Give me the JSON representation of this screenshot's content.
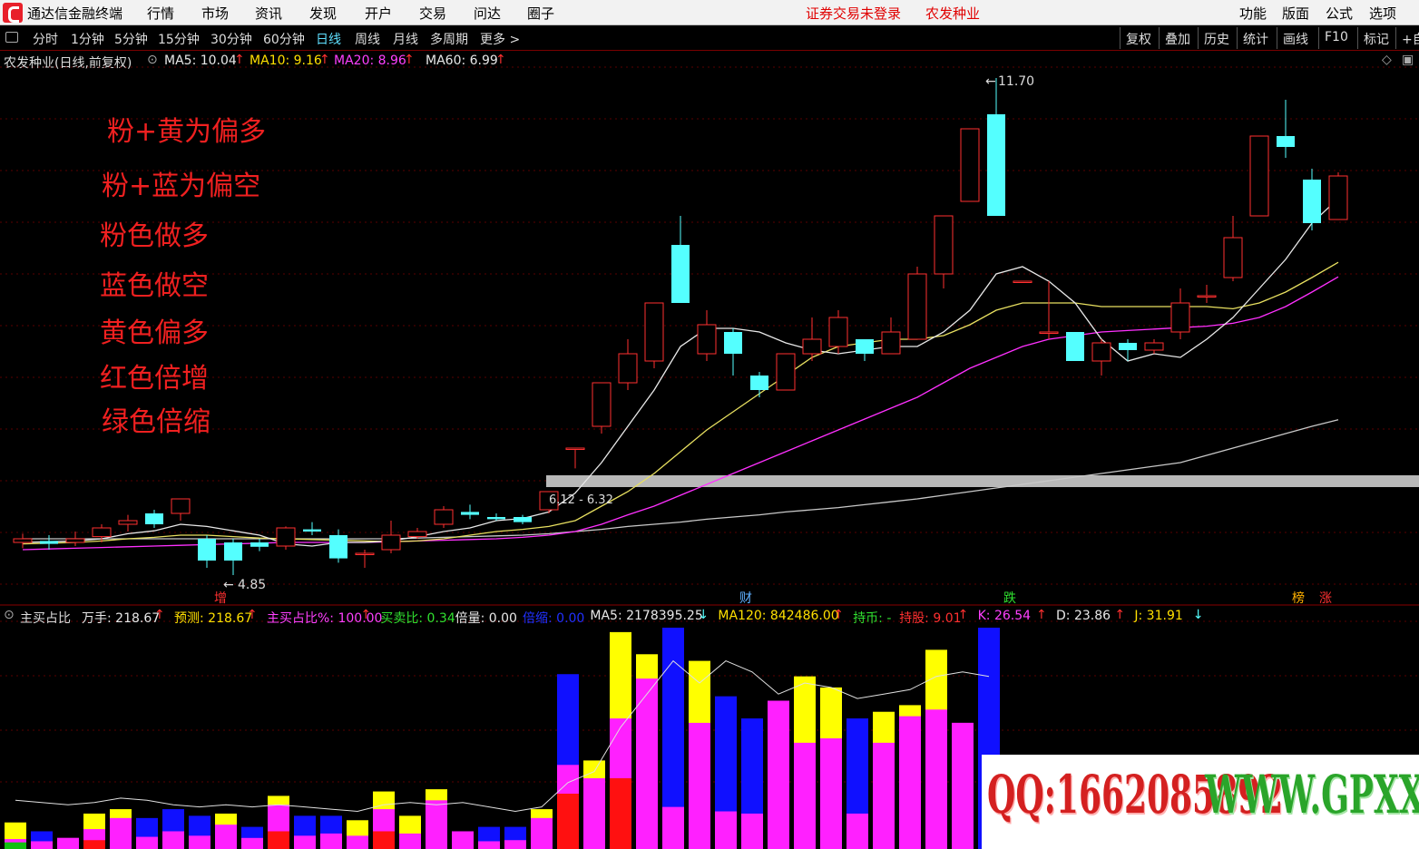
{
  "app": {
    "title": "通达信金融终端",
    "menu": [
      "行情",
      "市场",
      "资讯",
      "发现",
      "开户",
      "交易",
      "问达",
      "圈子"
    ],
    "login_status": "证券交易未登录",
    "stock_name": "农发种业",
    "right_menu": [
      "功能",
      "版面",
      "公式",
      "选项"
    ]
  },
  "toolbar": {
    "periods": [
      "分时",
      "1分钟",
      "5分钟",
      "15分钟",
      "30分钟",
      "60分钟",
      "日线",
      "周线",
      "月线",
      "多周期",
      "更多 >"
    ],
    "selected_period": "日线",
    "right_buttons": [
      "复权",
      "叠加",
      "历史",
      "统计",
      "画线",
      "F10",
      "标记",
      "+自"
    ]
  },
  "main_chart": {
    "title": "农发种业(日线,前复权)",
    "ma5": "MA5: 10.04",
    "ma10": "MA10: 9.16",
    "ma20": "MA20: 8.96",
    "ma60": "MA60: 6.99",
    "high_label": "11.70",
    "low_label": "4.85",
    "range_label": "6.12 - 6.32",
    "notes": [
      "粉+黄为偏多",
      "粉+蓝为偏空",
      "粉色做多",
      "蓝色做空",
      "黄色偏多",
      "红色倍增",
      "绿色倍缩"
    ],
    "events": [
      {
        "text": "增",
        "color": "#ff3030"
      },
      {
        "text": "财",
        "color": "#5fb0ff"
      },
      {
        "text": "跌",
        "color": "#30e030"
      },
      {
        "text": "榜",
        "color": "#ffb000"
      },
      {
        "text": "涨",
        "color": "#ff3030"
      }
    ],
    "colors": {
      "up": "#ff3030",
      "down": "#54ffff",
      "ma5": "#e8e8e8",
      "ma10": "#e8e060",
      "ma20": "#ff30ff",
      "ma60": "#c8c8c8"
    }
  },
  "candles": [
    {
      "o": 5.3,
      "c": 5.35,
      "h": 5.42,
      "l": 5.22
    },
    {
      "o": 5.32,
      "c": 5.28,
      "h": 5.4,
      "l": 5.2
    },
    {
      "o": 5.3,
      "c": 5.35,
      "h": 5.45,
      "l": 5.25
    },
    {
      "o": 5.38,
      "c": 5.5,
      "h": 5.55,
      "l": 5.3
    },
    {
      "o": 5.55,
      "c": 5.6,
      "h": 5.68,
      "l": 5.45
    },
    {
      "o": 5.7,
      "c": 5.55,
      "h": 5.75,
      "l": 5.5
    },
    {
      "o": 5.7,
      "c": 5.9,
      "h": 5.9,
      "l": 5.6
    },
    {
      "o": 5.35,
      "c": 5.05,
      "h": 5.4,
      "l": 4.95
    },
    {
      "o": 5.3,
      "c": 5.05,
      "h": 5.35,
      "l": 4.85
    },
    {
      "o": 5.3,
      "c": 5.24,
      "h": 5.35,
      "l": 5.18
    },
    {
      "o": 5.25,
      "c": 5.5,
      "h": 5.52,
      "l": 5.2
    },
    {
      "o": 5.48,
      "c": 5.45,
      "h": 5.58,
      "l": 5.4
    },
    {
      "o": 5.4,
      "c": 5.08,
      "h": 5.48,
      "l": 5.02
    },
    {
      "o": 5.15,
      "c": 5.15,
      "h": 5.2,
      "l": 4.95
    },
    {
      "o": 5.2,
      "c": 5.4,
      "h": 5.6,
      "l": 5.15
    },
    {
      "o": 5.38,
      "c": 5.45,
      "h": 5.5,
      "l": 5.35
    },
    {
      "o": 5.55,
      "c": 5.75,
      "h": 5.8,
      "l": 5.5
    },
    {
      "o": 5.72,
      "c": 5.68,
      "h": 5.82,
      "l": 5.62
    },
    {
      "o": 5.65,
      "c": 5.62,
      "h": 5.7,
      "l": 5.6
    },
    {
      "o": 5.65,
      "c": 5.58,
      "h": 5.68,
      "l": 5.55
    },
    {
      "o": 5.75,
      "c": 6.0,
      "h": 6.0,
      "l": 5.7
    },
    {
      "o": 6.6,
      "c": 6.6,
      "h": 6.6,
      "l": 6.32
    },
    {
      "o": 6.9,
      "c": 7.5,
      "h": 7.5,
      "l": 6.8
    },
    {
      "o": 7.5,
      "c": 7.9,
      "h": 8.1,
      "l": 7.4
    },
    {
      "o": 7.8,
      "c": 8.6,
      "h": 8.6,
      "l": 7.7
    },
    {
      "o": 9.4,
      "c": 8.6,
      "h": 9.8,
      "l": 8.6
    },
    {
      "o": 7.9,
      "c": 8.3,
      "h": 8.5,
      "l": 7.8
    },
    {
      "o": 8.2,
      "c": 7.9,
      "h": 8.25,
      "l": 7.6
    },
    {
      "o": 7.6,
      "c": 7.4,
      "h": 7.65,
      "l": 7.3
    },
    {
      "o": 7.4,
      "c": 7.9,
      "h": 7.9,
      "l": 7.4
    },
    {
      "o": 7.9,
      "c": 8.1,
      "h": 8.4,
      "l": 7.8
    },
    {
      "o": 8.0,
      "c": 8.4,
      "h": 8.5,
      "l": 7.9
    },
    {
      "o": 8.1,
      "c": 7.9,
      "h": 8.1,
      "l": 7.8
    },
    {
      "o": 7.9,
      "c": 8.2,
      "h": 8.4,
      "l": 7.9
    },
    {
      "o": 8.1,
      "c": 9.0,
      "h": 9.1,
      "l": 8.1
    },
    {
      "o": 9.0,
      "c": 9.8,
      "h": 9.8,
      "l": 8.8
    },
    {
      "o": 10.0,
      "c": 11.0,
      "h": 11.0,
      "l": 10.0
    },
    {
      "o": 11.2,
      "c": 9.8,
      "h": 11.7,
      "l": 9.8
    },
    {
      "o": 8.9,
      "c": 8.9,
      "h": 8.9,
      "l": 8.9
    },
    {
      "o": 8.2,
      "c": 8.2,
      "h": 8.9,
      "l": 8.1
    },
    {
      "o": 8.2,
      "c": 7.8,
      "h": 8.2,
      "l": 7.8
    },
    {
      "o": 7.8,
      "c": 8.05,
      "h": 8.1,
      "l": 7.6
    },
    {
      "o": 8.05,
      "c": 7.95,
      "h": 8.1,
      "l": 7.8
    },
    {
      "o": 7.95,
      "c": 8.05,
      "h": 8.1,
      "l": 7.9
    },
    {
      "o": 8.2,
      "c": 8.6,
      "h": 8.8,
      "l": 8.1
    },
    {
      "o": 8.7,
      "c": 8.7,
      "h": 8.85,
      "l": 8.6
    },
    {
      "o": 8.95,
      "c": 9.5,
      "h": 9.8,
      "l": 8.9
    },
    {
      "o": 9.8,
      "c": 10.9,
      "h": 10.9,
      "l": 9.8
    },
    {
      "o": 10.9,
      "c": 10.75,
      "h": 11.4,
      "l": 10.6
    },
    {
      "o": 10.3,
      "c": 9.7,
      "h": 10.45,
      "l": 9.6
    },
    {
      "o": 9.75,
      "c": 10.35,
      "h": 10.4,
      "l": 9.75
    }
  ],
  "ma_lines": {
    "ma5": [
      5.3,
      5.31,
      5.32,
      5.35,
      5.42,
      5.46,
      5.55,
      5.52,
      5.46,
      5.4,
      5.28,
      5.25,
      5.3,
      5.3,
      5.32,
      5.38,
      5.45,
      5.5,
      5.6,
      5.63,
      5.72,
      5.98,
      6.4,
      6.9,
      7.4,
      8.0,
      8.25,
      8.25,
      8.2,
      8.05,
      7.95,
      7.9,
      7.95,
      8.0,
      8.0,
      8.2,
      8.5,
      9.0,
      9.1,
      8.9,
      8.6,
      8.1,
      7.8,
      7.9,
      7.85,
      8.1,
      8.4,
      8.8,
      9.2,
      9.7,
      10.04
    ],
    "ma10": [
      5.28,
      5.29,
      5.3,
      5.32,
      5.35,
      5.37,
      5.4,
      5.4,
      5.38,
      5.36,
      5.35,
      5.34,
      5.33,
      5.32,
      5.31,
      5.32,
      5.35,
      5.4,
      5.45,
      5.48,
      5.52,
      5.6,
      5.8,
      6.0,
      6.25,
      6.55,
      6.85,
      7.1,
      7.35,
      7.6,
      7.85,
      8.0,
      8.05,
      8.1,
      8.1,
      8.15,
      8.3,
      8.5,
      8.6,
      8.6,
      8.6,
      8.55,
      8.55,
      8.55,
      8.55,
      8.55,
      8.52,
      8.6,
      8.75,
      8.95,
      9.16
    ],
    "ma20": [
      5.2,
      5.21,
      5.22,
      5.23,
      5.24,
      5.25,
      5.26,
      5.27,
      5.28,
      5.29,
      5.3,
      5.3,
      5.3,
      5.3,
      5.31,
      5.32,
      5.33,
      5.34,
      5.35,
      5.37,
      5.4,
      5.45,
      5.55,
      5.68,
      5.8,
      5.95,
      6.1,
      6.25,
      6.4,
      6.55,
      6.7,
      6.85,
      7.0,
      7.15,
      7.3,
      7.5,
      7.7,
      7.85,
      8.0,
      8.1,
      8.15,
      8.2,
      8.22,
      8.24,
      8.26,
      8.28,
      8.32,
      8.4,
      8.55,
      8.75,
      8.96
    ],
    "ma60": [
      5.35,
      5.35,
      5.35,
      5.35,
      5.35,
      5.35,
      5.35,
      5.35,
      5.35,
      5.35,
      5.35,
      5.35,
      5.35,
      5.35,
      5.35,
      5.36,
      5.37,
      5.38,
      5.39,
      5.4,
      5.42,
      5.45,
      5.48,
      5.52,
      5.55,
      5.58,
      5.62,
      5.65,
      5.68,
      5.72,
      5.75,
      5.78,
      5.82,
      5.86,
      5.9,
      5.95,
      6.0,
      6.05,
      6.1,
      6.15,
      6.2,
      6.25,
      6.3,
      6.35,
      6.4,
      6.5,
      6.6,
      6.7,
      6.8,
      6.9,
      6.99
    ]
  },
  "indicator": {
    "name": "主买占比",
    "items": [
      {
        "text": "万手: 218.67",
        "color": "#e8e8e8",
        "arrow": "↑",
        "arrow_color": "#ff3030"
      },
      {
        "text": "预测: 218.67",
        "color": "#ffe000",
        "arrow": "↑",
        "arrow_color": "#ff3030"
      },
      {
        "text": "主买占比%: 100.00",
        "color": "#ff40ff",
        "arrow": "↑",
        "arrow_color": "#ff3030"
      },
      {
        "text": "买卖比: 0.34",
        "color": "#30e030",
        "arrow": "",
        "arrow_color": ""
      },
      {
        "text": "倍量: 0.00",
        "color": "#e8e8e8",
        "arrow": "",
        "arrow_color": ""
      },
      {
        "text": "倍缩: 0.00",
        "color": "#2030ff",
        "arrow": "",
        "arrow_color": ""
      },
      {
        "text": "MA5: 2178395.25",
        "color": "#e8e8e8",
        "arrow": "↓",
        "arrow_color": "#54ffff"
      },
      {
        "text": "MA120: 842486.00",
        "color": "#ffe000",
        "arrow": "↑",
        "arrow_color": "#ff3030"
      },
      {
        "text": "持币: -",
        "color": "#30e030",
        "arrow": "",
        "arrow_color": ""
      },
      {
        "text": "持股: 9.01",
        "color": "#ff3030",
        "arrow": "↑",
        "arrow_color": "#ff3030"
      },
      {
        "text": "K: 26.54",
        "color": "#ff40ff",
        "arrow": "↑",
        "arrow_color": "#ff3030"
      },
      {
        "text": "D: 23.86",
        "color": "#e8e8e8",
        "arrow": "↑",
        "arrow_color": "#ff3030"
      },
      {
        "text": "J: 31.91",
        "color": "#ffe000",
        "arrow": "↓",
        "arrow_color": "#54ffff"
      }
    ],
    "colors": {
      "pink": "#ff20ff",
      "yellow": "#ffff00",
      "blue": "#1010ff",
      "red": "#ff1010",
      "green": "#10c010"
    }
  },
  "volume_bars": [
    {
      "t": 0.12,
      "c": "Y",
      "ph": 0.045,
      "rh": 0,
      "gh": 0.03
    },
    {
      "t": 0.08,
      "c": "B",
      "ph": 0.035,
      "rh": 0,
      "gh": 0
    },
    {
      "t": 0.05,
      "c": "P",
      "ph": 0.05,
      "rh": 0,
      "gh": 0
    },
    {
      "t": 0.16,
      "c": "Y",
      "ph": 0.09,
      "rh": 0.04,
      "gh": 0
    },
    {
      "t": 0.18,
      "c": "Y",
      "ph": 0.14,
      "rh": 0,
      "gh": 0
    },
    {
      "t": 0.14,
      "c": "B",
      "ph": 0.055,
      "rh": 0,
      "gh": 0
    },
    {
      "t": 0.18,
      "c": "B",
      "ph": 0.08,
      "rh": 0,
      "gh": 0
    },
    {
      "t": 0.15,
      "c": "B",
      "ph": 0.06,
      "rh": 0,
      "gh": 0
    },
    {
      "t": 0.16,
      "c": "Y",
      "ph": 0.11,
      "rh": 0,
      "gh": 0
    },
    {
      "t": 0.1,
      "c": "B",
      "ph": 0.05,
      "rh": 0,
      "gh": 0
    },
    {
      "t": 0.24,
      "c": "Y",
      "ph": 0.2,
      "rh": 0.08,
      "gh": 0
    },
    {
      "t": 0.15,
      "c": "B",
      "ph": 0.06,
      "rh": 0,
      "gh": 0
    },
    {
      "t": 0.15,
      "c": "B",
      "ph": 0.07,
      "rh": 0,
      "gh": 0
    },
    {
      "t": 0.13,
      "c": "Y",
      "ph": 0.06,
      "rh": 0,
      "gh": 0
    },
    {
      "t": 0.26,
      "c": "Y",
      "ph": 0.18,
      "rh": 0.08,
      "gh": 0
    },
    {
      "t": 0.15,
      "c": "Y",
      "ph": 0.07,
      "rh": 0,
      "gh": 0
    },
    {
      "t": 0.27,
      "c": "Y",
      "ph": 0.22,
      "rh": 0,
      "gh": 0
    },
    {
      "t": 0.08,
      "c": "B",
      "ph": 0.08,
      "rh": 0,
      "gh": 0
    },
    {
      "t": 0.1,
      "c": "B",
      "ph": 0.035,
      "rh": 0,
      "gh": 0
    },
    {
      "t": 0.1,
      "c": "B",
      "ph": 0.04,
      "rh": 0,
      "gh": 0
    },
    {
      "t": 0.18,
      "c": "Y",
      "ph": 0.14,
      "rh": 0,
      "gh": 0
    },
    {
      "t": 0.79,
      "c": "B",
      "ph": 0.38,
      "rh": 0.25,
      "gh": 0
    },
    {
      "t": 0.4,
      "c": "Y",
      "ph": 0.32,
      "rh": 0,
      "gh": 0
    },
    {
      "t": 0.98,
      "c": "Y",
      "ph": 0.59,
      "rh": 0.32,
      "gh": 0
    },
    {
      "t": 0.88,
      "c": "Y",
      "ph": 0.77,
      "rh": 0,
      "gh": 0
    },
    {
      "t": 1.0,
      "c": "B",
      "ph": 0.19,
      "rh": 0,
      "gh": 0
    },
    {
      "t": 0.85,
      "c": "Y",
      "ph": 0.57,
      "rh": 0,
      "gh": 0
    },
    {
      "t": 0.69,
      "c": "B",
      "ph": 0.17,
      "rh": 0,
      "gh": 0
    },
    {
      "t": 0.59,
      "c": "B",
      "ph": 0.16,
      "rh": 0,
      "gh": 0
    },
    {
      "t": 0.67,
      "c": "P",
      "ph": 0.67,
      "rh": 0,
      "gh": 0
    },
    {
      "t": 0.78,
      "c": "Y",
      "ph": 0.48,
      "rh": 0,
      "gh": 0
    },
    {
      "t": 0.73,
      "c": "Y",
      "ph": 0.5,
      "rh": 0,
      "gh": 0
    },
    {
      "t": 0.59,
      "c": "B",
      "ph": 0.16,
      "rh": 0,
      "gh": 0
    },
    {
      "t": 0.62,
      "c": "Y",
      "ph": 0.48,
      "rh": 0,
      "gh": 0
    },
    {
      "t": 0.65,
      "c": "Y",
      "ph": 0.6,
      "rh": 0,
      "gh": 0
    },
    {
      "t": 0.9,
      "c": "Y",
      "ph": 0.63,
      "rh": 0,
      "gh": 0
    },
    {
      "t": 0.57,
      "c": "P",
      "ph": 0.57,
      "rh": 0,
      "gh": 0
    },
    {
      "t": 1.0,
      "c": "B",
      "ph": 0.0,
      "rh": 0,
      "gh": 0
    }
  ],
  "indicator_line": [
    0.22,
    0.21,
    0.2,
    0.21,
    0.23,
    0.22,
    0.2,
    0.19,
    0.2,
    0.19,
    0.2,
    0.19,
    0.18,
    0.17,
    0.2,
    0.21,
    0.2,
    0.21,
    0.19,
    0.17,
    0.19,
    0.3,
    0.35,
    0.55,
    0.7,
    0.85,
    0.75,
    0.85,
    0.8,
    0.7,
    0.75,
    0.73,
    0.68,
    0.7,
    0.72,
    0.78,
    0.8,
    0.78
  ]
}
